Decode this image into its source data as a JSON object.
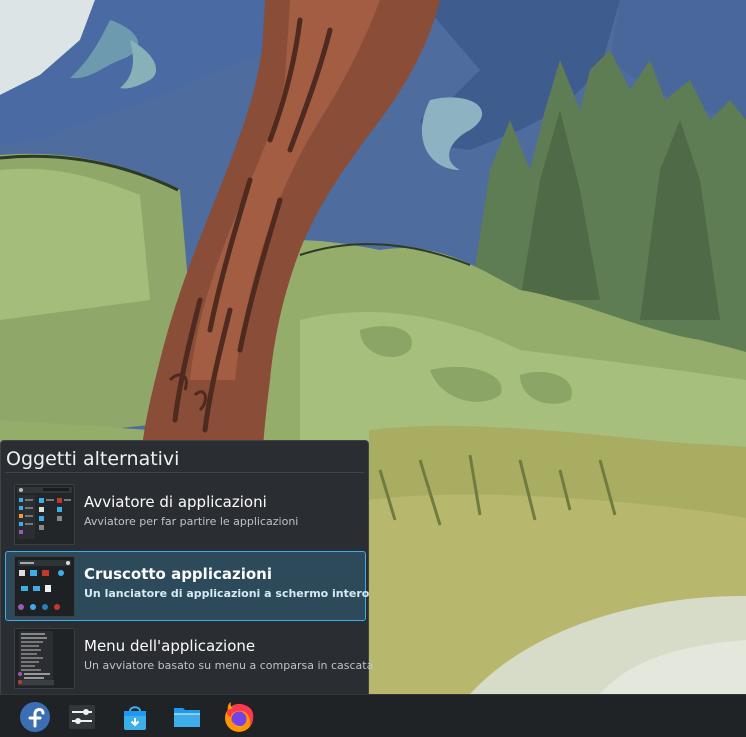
{
  "popup": {
    "title": "Oggetti alternativi",
    "items": [
      {
        "name": "Avviatore di applicazioni",
        "description": "Avviatore per far partire le applicazioni",
        "selected": false,
        "icon": "kickoff-preview-icon"
      },
      {
        "name": "Cruscotto applicazioni",
        "description": "Un lanciatore di applicazioni a schermo intero",
        "selected": true,
        "icon": "dashboard-preview-icon"
      },
      {
        "name": "Menu dell'applicazione",
        "description": "Un avviatore basato su menu a comparsa in cascata",
        "selected": false,
        "icon": "kicker-preview-icon"
      }
    ]
  },
  "taskbar": {
    "items": [
      {
        "name": "fedora-launcher",
        "icon": "fedora-icon"
      },
      {
        "name": "system-settings",
        "icon": "settings-sliders-icon"
      },
      {
        "name": "discover-store",
        "icon": "store-bag-icon"
      },
      {
        "name": "file-manager",
        "icon": "folder-icon"
      },
      {
        "name": "firefox",
        "icon": "firefox-icon"
      }
    ]
  },
  "colors": {
    "accent": "#3daee9",
    "selected_bg": "#2d4a5b",
    "popup_bg": "#2a2e32",
    "taskbar_bg": "#202326"
  }
}
